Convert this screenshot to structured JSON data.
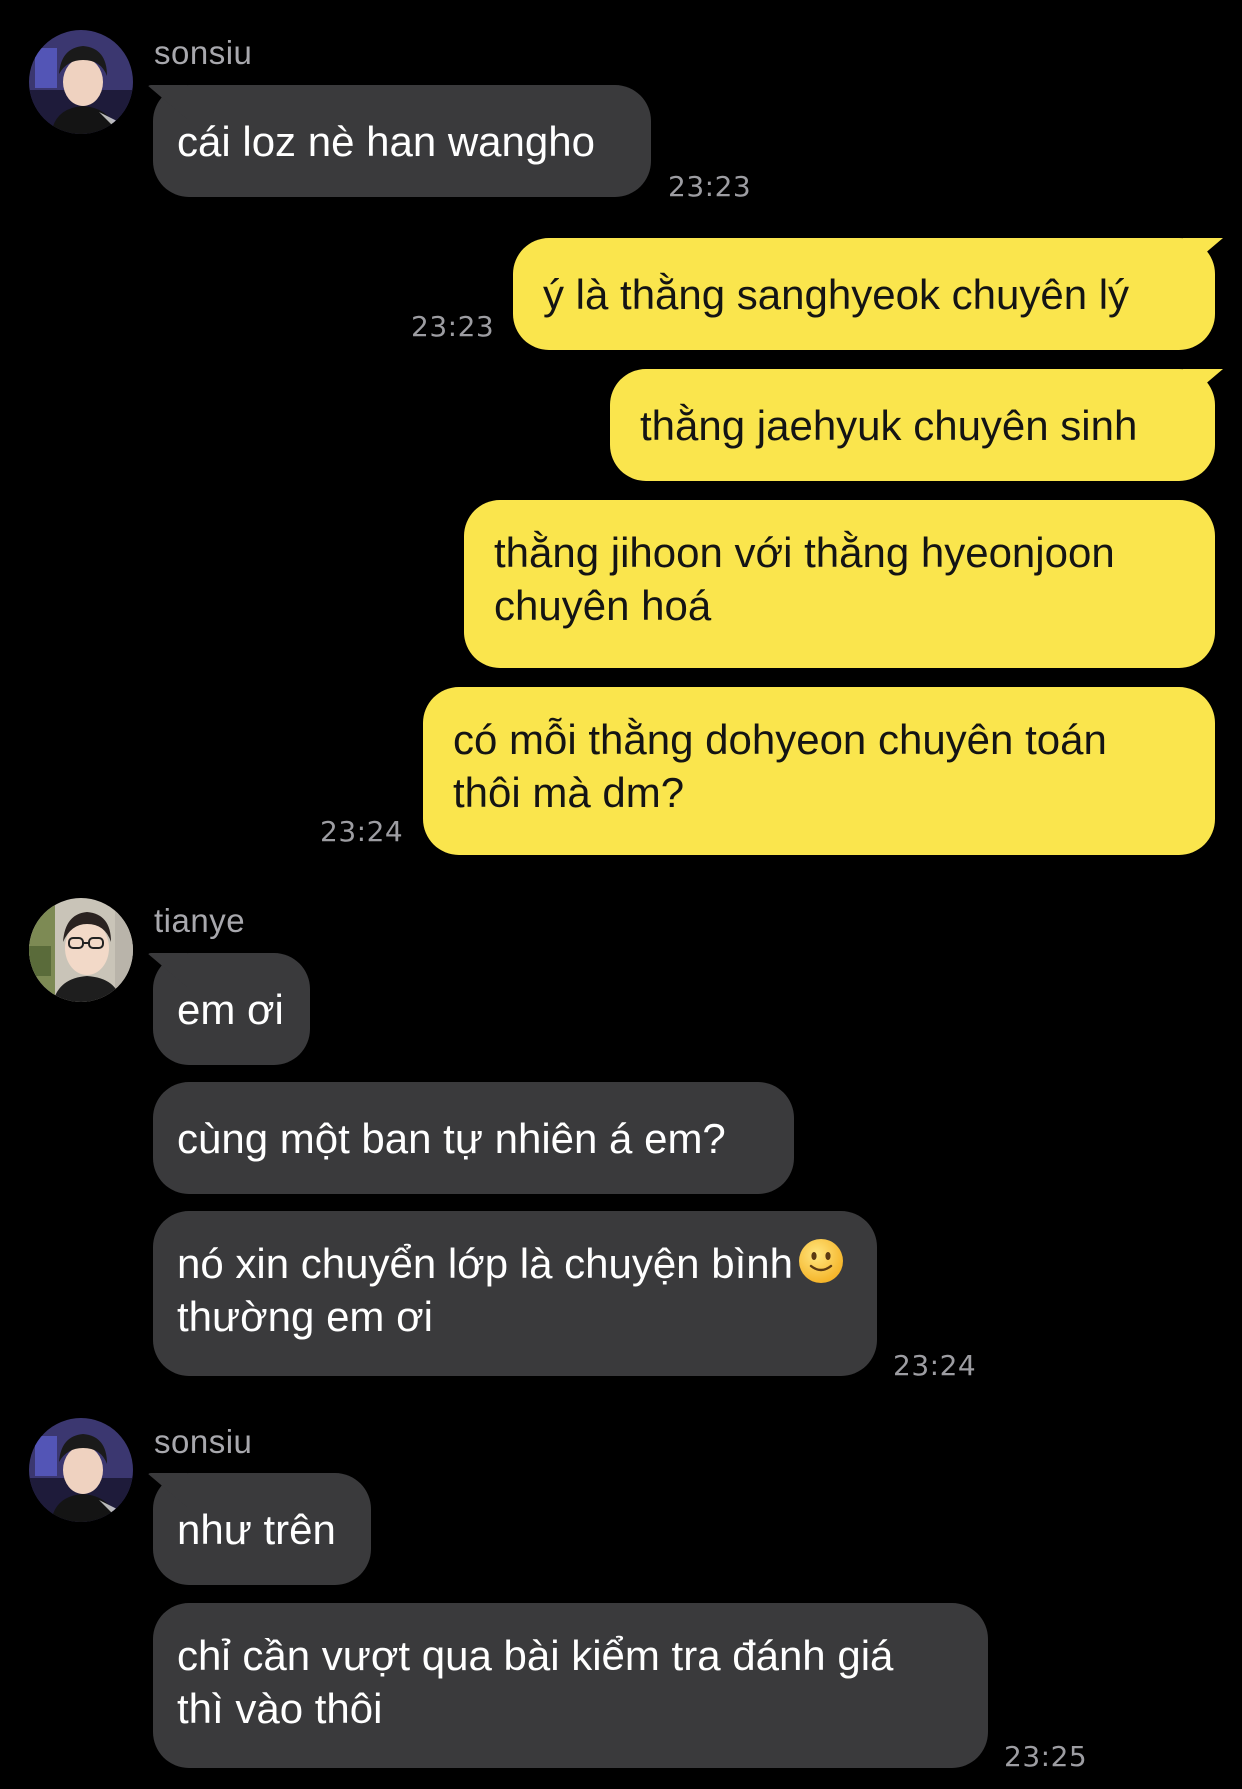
{
  "colors": {
    "background": "#000000",
    "incoming_bubble": "#3a3a3c",
    "outgoing_bubble": "#fae54d",
    "timestamp": "#9d9da2",
    "sender_name": "#a8a8ad"
  },
  "messages": [
    {
      "sender": "sonsiu",
      "avatar_icon": "avatar-sonsiu",
      "text": "cái loz nè han wangho",
      "time": "23:23"
    },
    {
      "text": "ý là thằng sanghyeok chuyên lý",
      "time": "23:23"
    },
    {
      "text": "thằng jaehyuk chuyên sinh"
    },
    {
      "text": "thằng jihoon với thằng hyeonjoon\nchuyên hoá"
    },
    {
      "text": "có mỗi thằng dohyeon chuyên toán\nthôi mà dm?",
      "time": "23:24"
    },
    {
      "sender": "tianye",
      "avatar_icon": "avatar-tianye",
      "text": "em ơi"
    },
    {
      "text": "cùng một ban tự nhiên á em?"
    },
    {
      "text": "nó xin chuyển lớp là chuyện bình\nthường em ơi",
      "emoji": "slightly-smiling-face-icon",
      "time": "23:24"
    },
    {
      "sender": "sonsiu",
      "avatar_icon": "avatar-sonsiu",
      "text": "như trên"
    },
    {
      "text": "chỉ cần vượt qua bài kiểm tra đánh giá\nthì vào thôi",
      "time": "23:25"
    }
  ]
}
